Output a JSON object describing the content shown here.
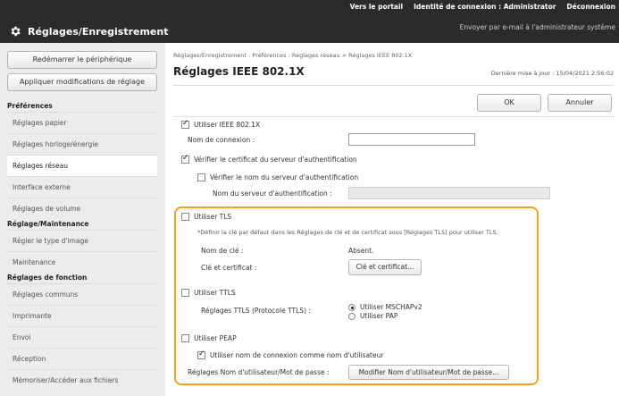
{
  "header": {
    "portal_link": "Vers le portail",
    "login_label": "Identité de connexion :",
    "login_user": "Administrator",
    "logout": "Déconnexion",
    "email_link": "Envoyer par e-mail à l'administrateur système",
    "app_title": "Réglages/Enregistrement"
  },
  "sidebar": {
    "restart_button": "Redémarrer le périphérique",
    "apply_button": "Appliquer modifications de réglage",
    "sections": [
      {
        "heading": "Préférences",
        "items": [
          "Réglages papier",
          "Réglages horloge/énergie",
          "Réglages réseau",
          "Interface externe",
          "Réglages de volume"
        ]
      },
      {
        "heading": "Réglage/Maintenance",
        "items": [
          "Régler le type d'image",
          "Maintenance"
        ]
      },
      {
        "heading": "Réglages de fonction",
        "items": [
          "Réglages communs",
          "Imprimante",
          "Envoi",
          "Réception",
          "Mémoriser/Accéder aux fichiers"
        ]
      }
    ],
    "active_item": "Réglages réseau"
  },
  "main": {
    "breadcrumb": "Réglages/Enregistrement : Préférences : Réglages réseau > Réglages IEEE 802.1X",
    "title": "Réglages IEEE 802.1X",
    "last_update": "Dernière mise à jour : 15/04/2021 2:56:02",
    "ok_button": "OK",
    "cancel_button": "Annuler",
    "use_ieee": "Utiliser IEEE 802.1X",
    "login_name_label": "Nom de connexion :",
    "login_name_value": "",
    "verify_cert": "Vérifier le certificat du serveur d'authentification",
    "verify_server_name": "Vérifier le nom du serveur d'authentification",
    "server_name_label": "Nom du serveur d'authentification :",
    "server_name_value": "",
    "use_tls": "Utiliser TLS",
    "tls_note": "*Définir la clé par défaut dans les Réglages de clé et de certificat sous [Réglages TLS] pour utiliser TLS.",
    "key_name_label": "Nom de clé :",
    "key_name_value": "Absent.",
    "key_cert_label": "Clé et certificat :",
    "key_cert_button": "Clé et certificat...",
    "use_ttls": "Utiliser TTLS",
    "ttls_settings_label": "Réglages TTLS (Protocole TTLS) :",
    "ttls_options": [
      "Utiliser MSCHAPv2",
      "Utiliser PAP"
    ],
    "ttls_selected": 0,
    "use_peap": "Utiliser PEAP",
    "use_login_as_user": "Utiliser nom de connexion comme nom d'utilisateur",
    "user_pwd_label": "Réglages Nom d'utilisateur/Mot de passe :",
    "user_pwd_button": "Modifier Nom d'utilisateur/Mot de passe..."
  },
  "checkbox_state": {
    "use_ieee": true,
    "verify_cert": true,
    "verify_server_name": false,
    "use_tls": false,
    "use_ttls": false,
    "use_peap": false,
    "use_login_as_user": true
  },
  "colors": {
    "header_bg": "#2b2b2b",
    "highlight": "#f2a01f"
  }
}
